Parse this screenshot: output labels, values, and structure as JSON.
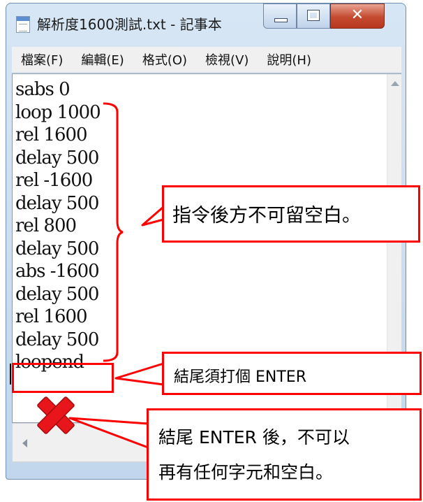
{
  "window": {
    "title": "解析度1600測試.txt - 記事本"
  },
  "menubar": {
    "items": [
      "檔案(F)",
      "編輯(E)",
      "格式(O)",
      "檢視(V)",
      "說明(H)"
    ]
  },
  "editor": {
    "lines": [
      "sabs 0",
      "loop 1000",
      "rel 1600",
      "delay 500",
      "rel -1600",
      "delay 500",
      "rel 800",
      "delay 500",
      "abs -1600",
      "delay 500",
      "rel 1600",
      "delay 500",
      "loopend"
    ]
  },
  "annotations": {
    "no_trailing_space": "指令後方不可留空白。",
    "end_enter": "結尾須打個 ENTER",
    "after_enter_line1": "結尾 ENTER 後，不可以",
    "after_enter_line2": "再有任何字元和空白。",
    "color": "#ff0000"
  }
}
